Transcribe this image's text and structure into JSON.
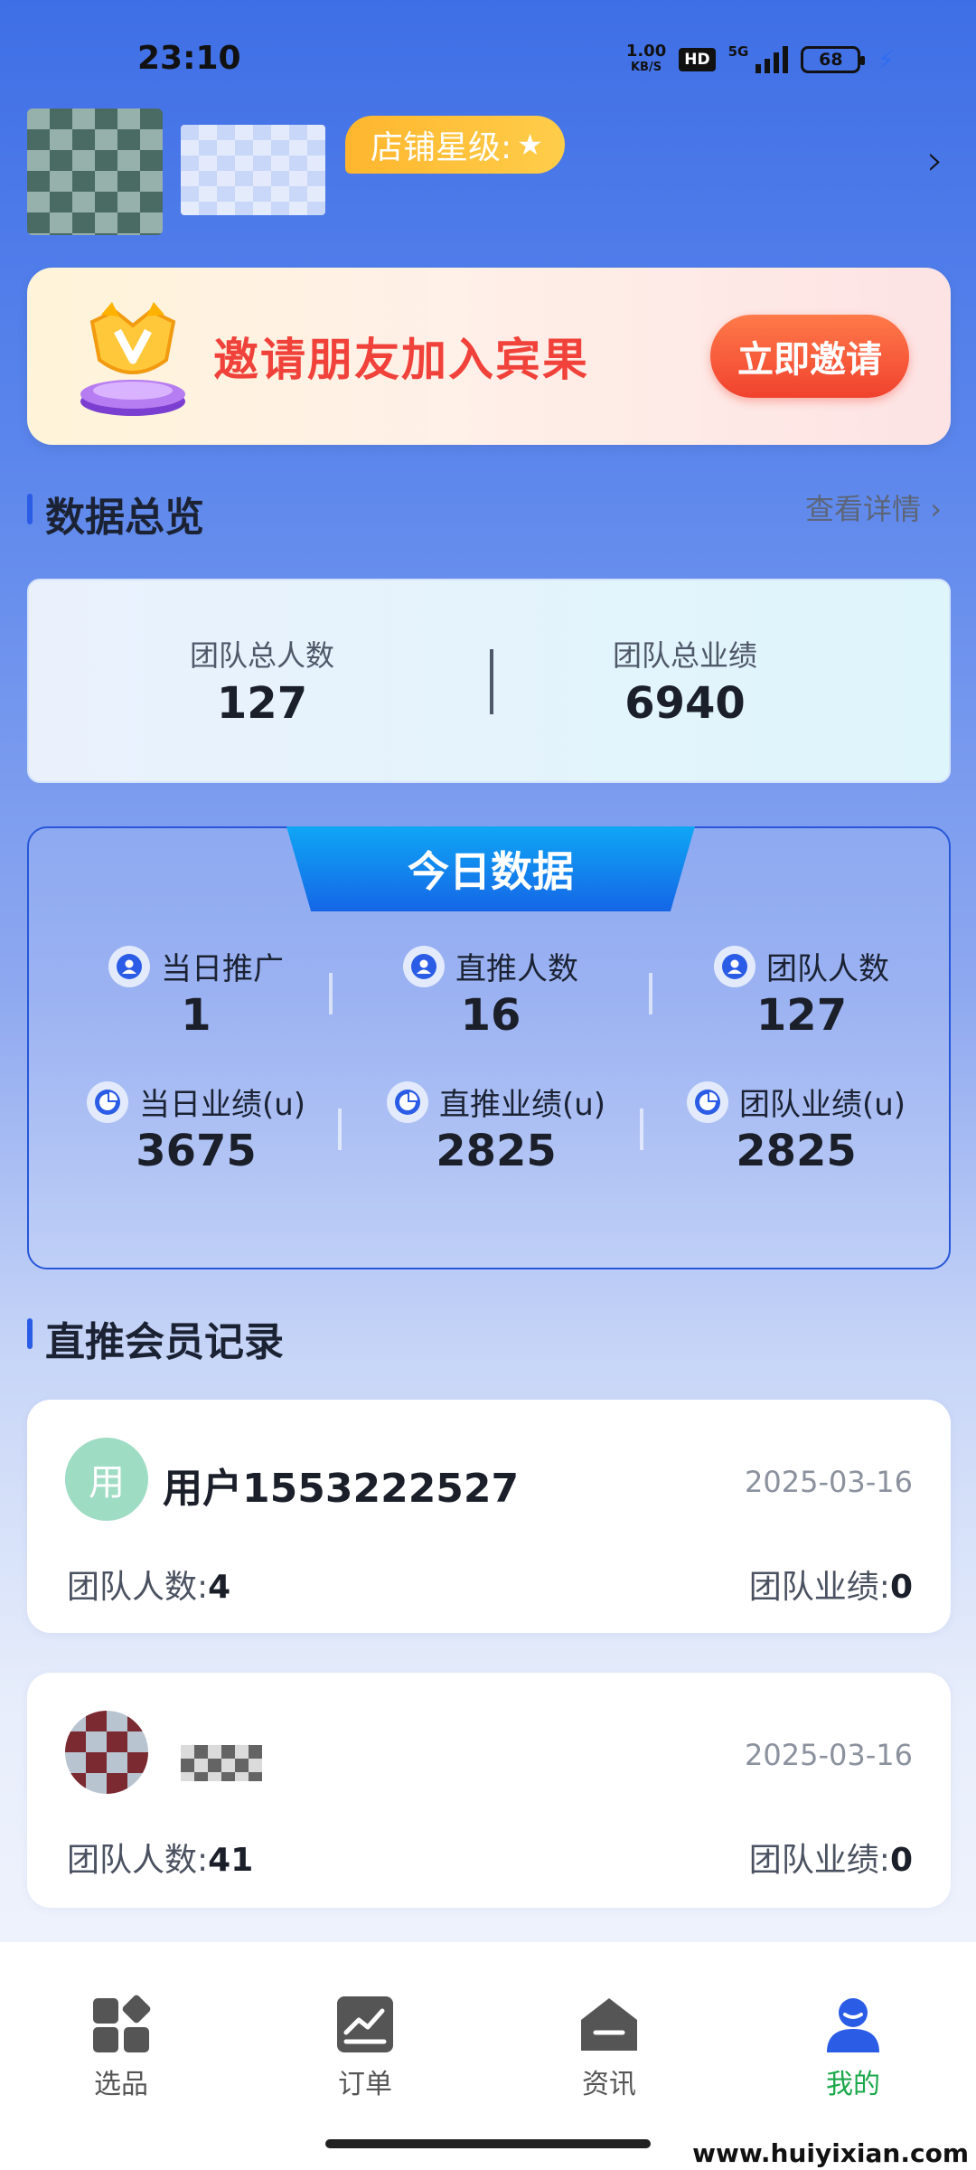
{
  "status_bar": {
    "time": "23:10",
    "net_speed_value": "1.00",
    "net_speed_unit": "KB/S",
    "hd": "HD",
    "signal_type": "5G",
    "battery": "68"
  },
  "profile": {
    "username": "",
    "store_star_label": "店铺星级:"
  },
  "invite": {
    "text": "邀请朋友加入宾果",
    "button": "立即邀请"
  },
  "overview": {
    "title": "数据总览",
    "view_details": "查看详情",
    "team_total_people_label": "团队总人数",
    "team_total_people_value": "127",
    "team_total_perf_label": "团队总业绩",
    "team_total_perf_value": "6940"
  },
  "today": {
    "title": "今日数据",
    "stats": [
      {
        "label": "当日推广",
        "value": "1",
        "icon": "user-icon"
      },
      {
        "label": "直推人数",
        "value": "16",
        "icon": "user-icon"
      },
      {
        "label": "团队人数",
        "value": "127",
        "icon": "user-icon"
      },
      {
        "label": "当日业绩(u)",
        "value": "3675",
        "icon": "pie-chart-icon"
      },
      {
        "label": "直推业绩(u)",
        "value": "2825",
        "icon": "pie-chart-icon"
      },
      {
        "label": "团队业绩(u)",
        "value": "2825",
        "icon": "pie-chart-icon"
      }
    ]
  },
  "members": {
    "title": "直推会员记录",
    "items": [
      {
        "avatar_text": "用",
        "name": "用户1553222527",
        "date": "2025-03-16",
        "team_count_label": "团队人数:",
        "team_count": "4",
        "team_perf_label": "团队业绩:",
        "team_perf": "0",
        "avatar_color": "#9fdcc4"
      },
      {
        "avatar_text": "",
        "name": "",
        "date": "2025-03-16",
        "team_count_label": "团队人数:",
        "team_count": "41",
        "team_perf_label": "团队业绩:",
        "team_perf": "0",
        "avatar_color": "#7a5a5a"
      }
    ]
  },
  "nav": {
    "items": [
      {
        "label": "选品",
        "icon": "grid-icon"
      },
      {
        "label": "订单",
        "icon": "chart-icon"
      },
      {
        "label": "资讯",
        "icon": "news-icon"
      },
      {
        "label": "我的",
        "icon": "profile-icon",
        "active": true
      }
    ]
  },
  "watermark": "www.huiyixian.com",
  "colors": {
    "accent": "#2b5ce6",
    "invite_red": "#f0423a",
    "active_nav": "#1aa84a",
    "star_gold": "#ffb62e"
  }
}
